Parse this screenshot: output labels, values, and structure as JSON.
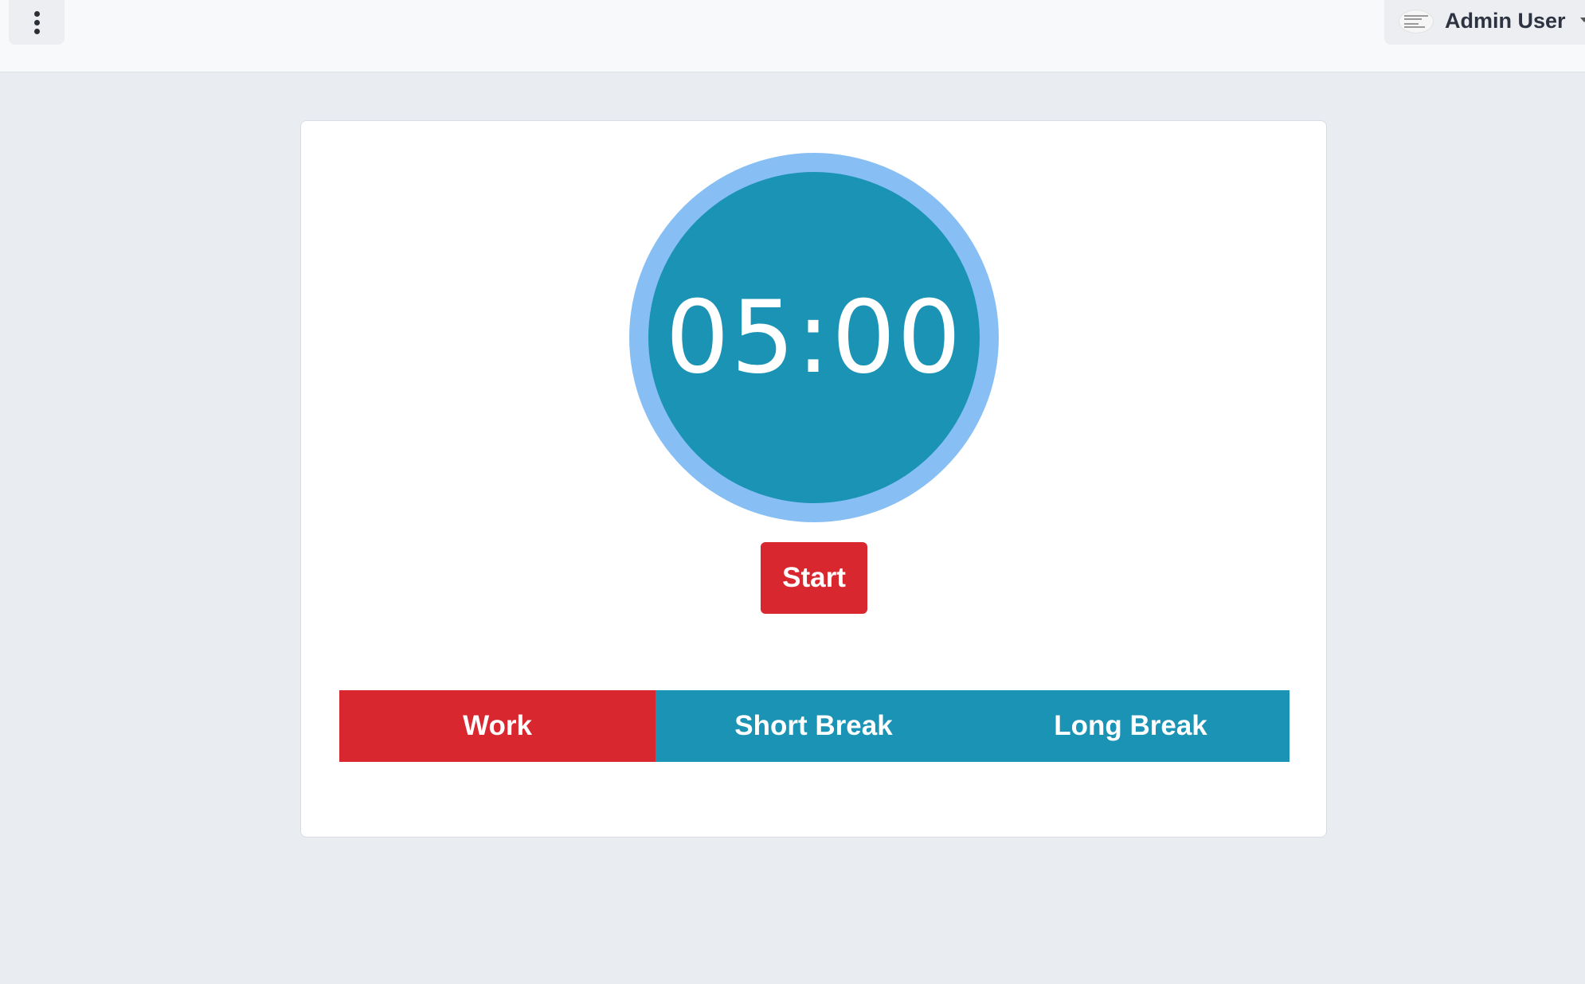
{
  "header": {
    "menu_icon": "kebab-menu-icon",
    "user": {
      "name": "Admin User",
      "caret_icon": "chevron-down-icon"
    }
  },
  "timer": {
    "display": "05:00",
    "ring_color": "#87bff4",
    "face_color": "#1b93b4"
  },
  "controls": {
    "start_label": "Start",
    "start_color": "#d8272f"
  },
  "modes": {
    "active": "Work",
    "active_color": "#d8272f",
    "inactive_color": "#1b93b4",
    "tabs": [
      {
        "label": "Work"
      },
      {
        "label": "Short Break"
      },
      {
        "label": "Long Break"
      }
    ]
  }
}
